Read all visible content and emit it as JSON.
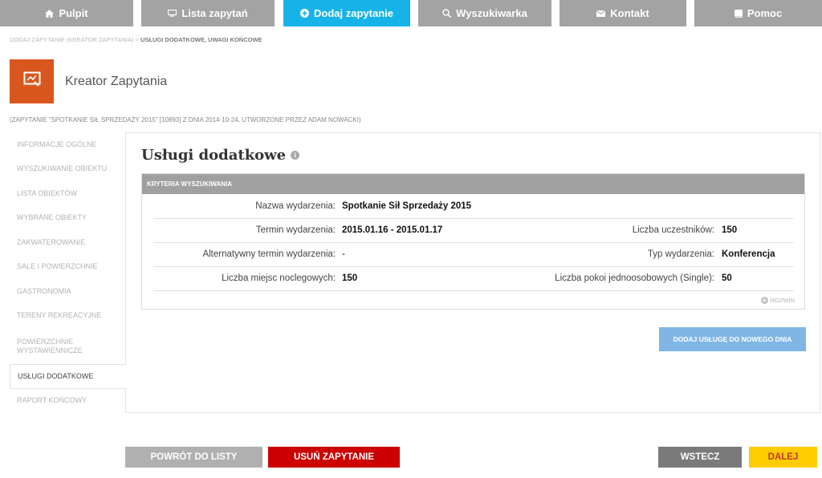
{
  "nav": [
    {
      "label": "Pulpit",
      "icon": "home-icon",
      "active": false
    },
    {
      "label": "Lista zapytań",
      "icon": "screen-icon",
      "active": false
    },
    {
      "label": "Dodaj zapytanie",
      "icon": "plus-circle-icon",
      "active": true
    },
    {
      "label": "Wyszukiwarka",
      "icon": "search-icon",
      "active": false
    },
    {
      "label": "Kontakt",
      "icon": "envelope-icon",
      "active": false
    },
    {
      "label": "Pomoc",
      "icon": "book-icon",
      "active": false
    }
  ],
  "breadcrumb": {
    "parent": "DODAJ ZAPYTANIE (KREATOR ZAPYTANIA) > ",
    "current": "USŁUGI DODATKOWE, UWAGI KOŃCOWE"
  },
  "header": {
    "title": "Kreator Zapytania",
    "meta": "(ZAPYTANIE \"SPOTKANIE SIŁ SPRZEDAŻY 2015\" [10893] Z DNIA 2014-10-24, UTWORZONE PRZEZ ADAM NOWACKI)"
  },
  "sidebar": {
    "items": [
      {
        "label": "INFORMACJE OGÓLNE"
      },
      {
        "label": "WYSZUKIWANIE OBIEKTU"
      },
      {
        "label": "LISTA OBIEKTÓW"
      },
      {
        "label": "WYBRANE OBIEKTY"
      },
      {
        "label": "ZAKWATEROWANIE"
      },
      {
        "label": "SALE I POWIERZCHNIE"
      },
      {
        "label": "GASTRONOMIA"
      },
      {
        "label": "TERENY REKREACYJNE"
      },
      {
        "label": "POWIERZCHNIE WYSTAWIENNICZE"
      },
      {
        "label": "USŁUGI DODATKOWE"
      },
      {
        "label": "RAPORT KOŃCOWY"
      }
    ]
  },
  "main": {
    "title": "Usługi dodatkowe",
    "criteria": {
      "header": "KRYTERIA WYSZUKIWANIA",
      "rows": [
        {
          "left_label": "Nazwa wydarzenia:",
          "left_value": "Spotkanie Sił Sprzedaży 2015",
          "right_label": "",
          "right_value": ""
        },
        {
          "left_label": "Termin wydarzenia:",
          "left_value": "2015.01.16 - 2015.01.17",
          "right_label": "Liczba uczestników:",
          "right_value": "150"
        },
        {
          "left_label": "Alternatywny termin wydarzenia:",
          "left_value": "-",
          "right_label": "Typ wydarzenia:",
          "right_value": "Konferencja"
        },
        {
          "left_label": "Liczba miejsc noclegowych:",
          "left_value": "150",
          "right_label": "Liczba pokoi jednoosobowych (Single):",
          "right_value": "50"
        }
      ],
      "expand_label": "ROZWIN"
    },
    "add_service_label": "DODAJ USŁUGĘ DO NOWEGO DNIA"
  },
  "footer": {
    "back_to_list": "POWRÓT DO LISTY",
    "delete": "USUŃ ZAPYTANIE",
    "back": "WSTECZ",
    "next": "DALEJ"
  },
  "colors": {
    "nav_active": "#17b3e8",
    "nav_inactive": "#a3a3a3",
    "logo": "#d9571f",
    "delete": "#cc0000",
    "next": "#ffcc00",
    "add_service": "#7fb6e6"
  }
}
